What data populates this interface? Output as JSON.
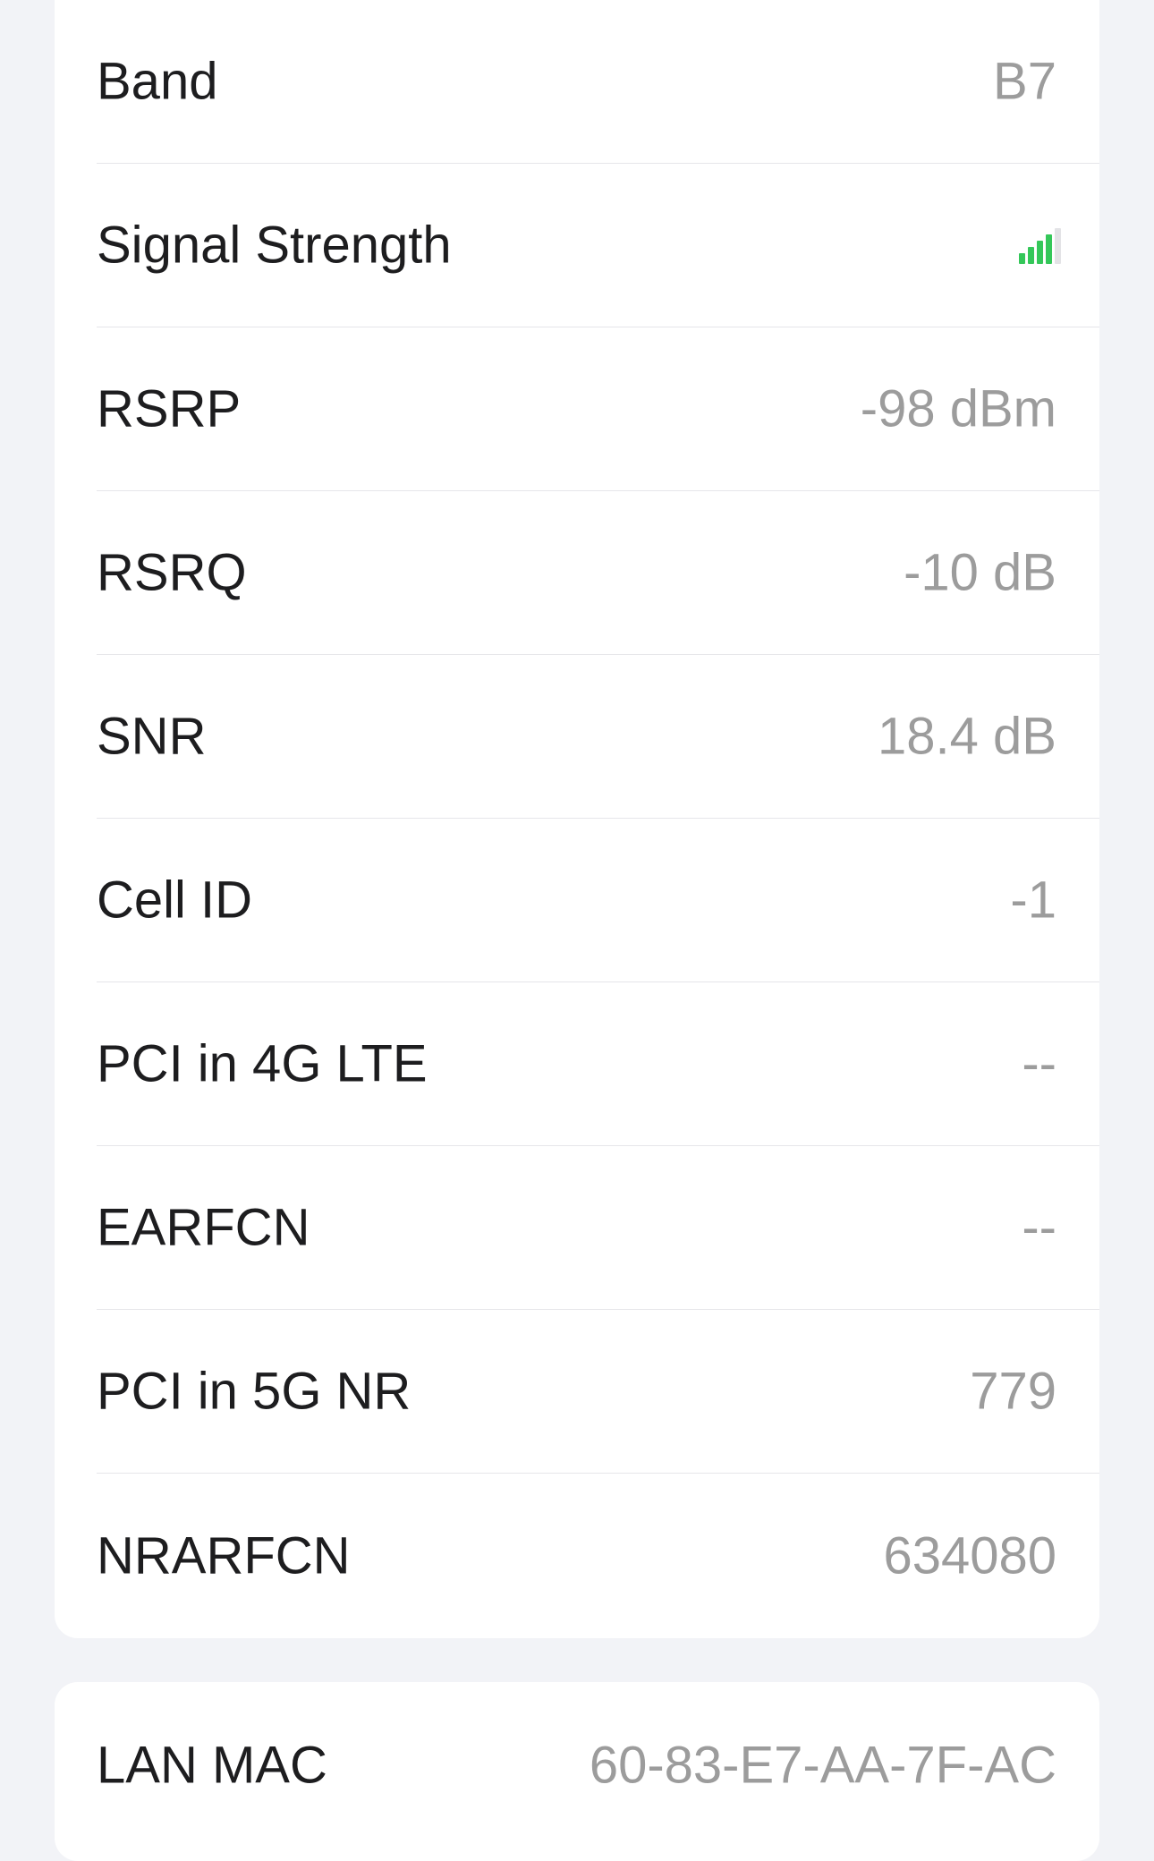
{
  "cellular": {
    "rows": [
      {
        "label": "Band",
        "value": "B7"
      },
      {
        "label": "Signal Strength",
        "value": null
      },
      {
        "label": "RSRP",
        "value": "-98 dBm"
      },
      {
        "label": "RSRQ",
        "value": "-10 dB"
      },
      {
        "label": "SNR",
        "value": "18.4 dB"
      },
      {
        "label": "Cell ID",
        "value": "-1"
      },
      {
        "label": "PCI in 4G LTE",
        "value": "--"
      },
      {
        "label": "EARFCN",
        "value": "--"
      },
      {
        "label": "PCI in 5G NR",
        "value": "779"
      },
      {
        "label": "NRARFCN",
        "value": "634080"
      }
    ],
    "signal": {
      "icon": "signal-bars-icon",
      "active_bars": 4,
      "total_bars": 5,
      "active_color": "#34c759",
      "inactive_color": "#e3e3e6"
    }
  },
  "lan": {
    "label": "LAN MAC",
    "value": "60-83-E7-AA-7F-AC"
  },
  "colors": {
    "background": "#f2f3f7",
    "card": "#ffffff",
    "label_text": "#1d1d1f",
    "value_text": "#9c9c9c",
    "divider": "#e6e6ea"
  }
}
